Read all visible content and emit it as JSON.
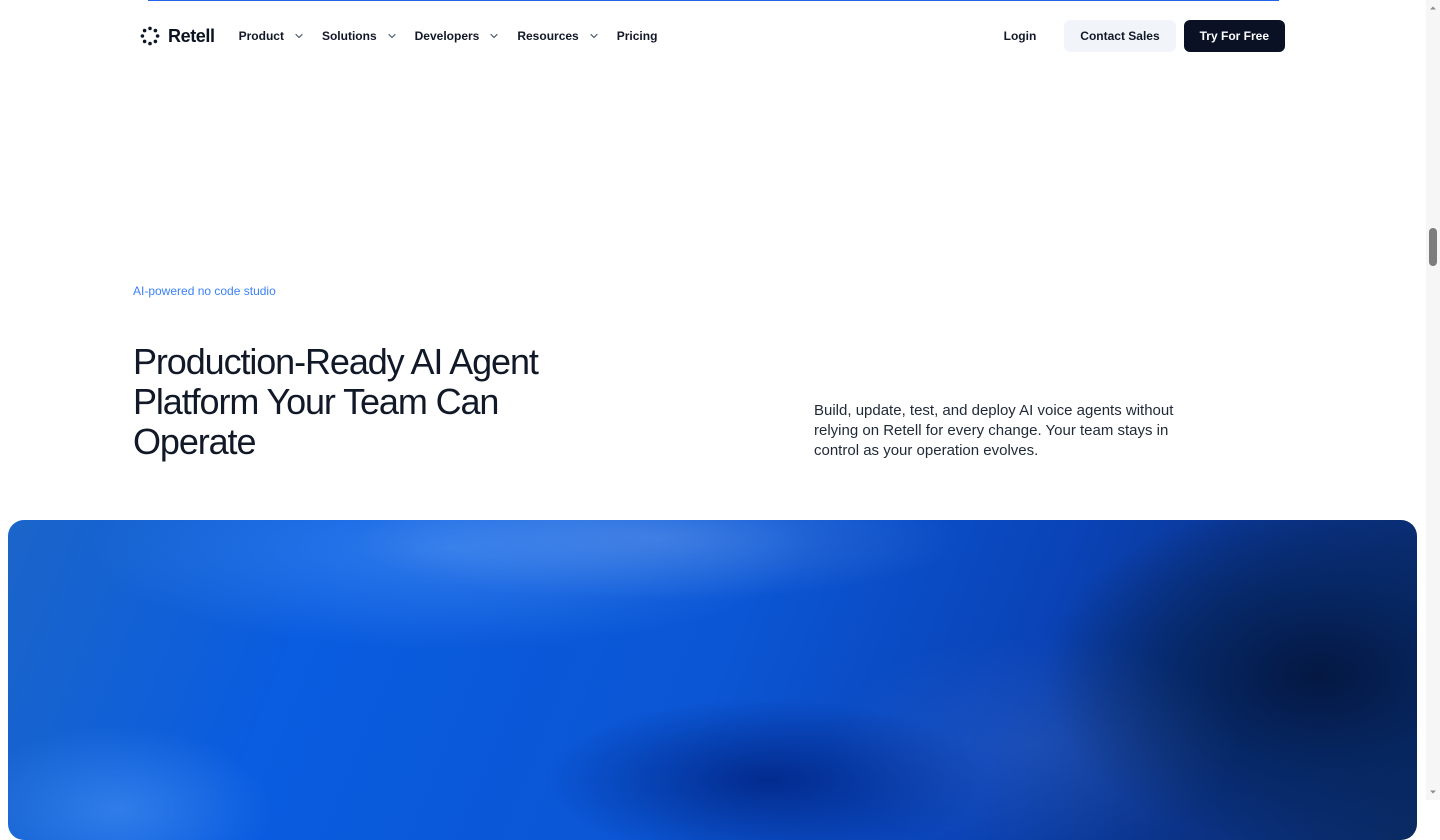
{
  "header": {
    "logo": {
      "text": "Retell",
      "icon": "dotted-circle-icon"
    },
    "nav": [
      {
        "label": "Product",
        "icon": "chevron-down-icon"
      },
      {
        "label": "Solutions",
        "icon": "chevron-down-icon"
      },
      {
        "label": "Developers",
        "icon": "chevron-down-icon"
      },
      {
        "label": "Resources",
        "icon": "chevron-down-icon"
      },
      {
        "label": "Pricing"
      }
    ],
    "actions": {
      "login": "Login",
      "contact_sales": "Contact Sales",
      "try_for_free": "Try For Free"
    }
  },
  "hero": {
    "eyebrow": "AI-powered no code studio",
    "title": "Production-Ready AI Agent Platform Your Team Can Operate",
    "description": "Build, update, test, and deploy AI voice agents without relying on Retell for every change. Your team stays in control as your operation evolves."
  },
  "colors": {
    "accent": "#3b82f6",
    "primary_button": "#0b1125",
    "secondary_button": "#f1f5f9",
    "top_line": "#2563eb",
    "hero_gradient": [
      "#1b65c9",
      "#0a5ce0",
      "#0a43b7",
      "#0a2a62"
    ]
  }
}
